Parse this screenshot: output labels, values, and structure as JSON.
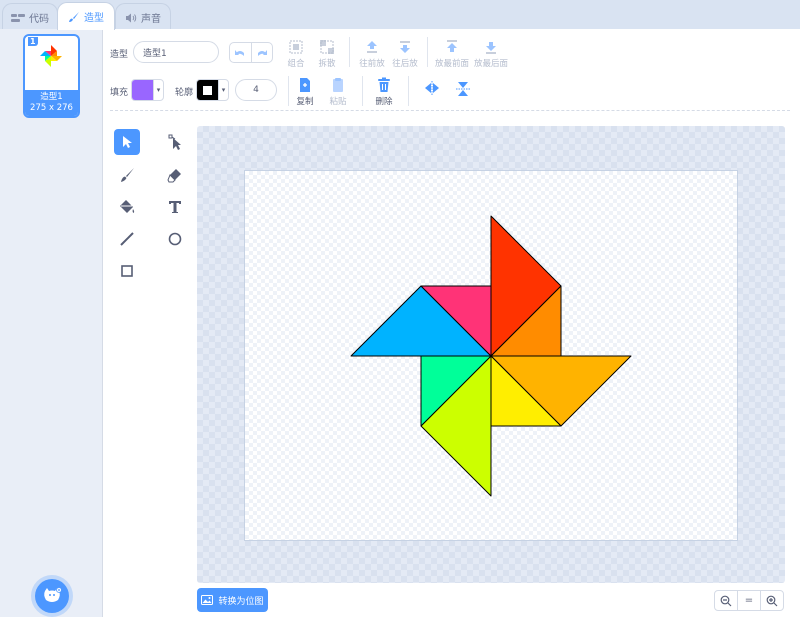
{
  "tabs": [
    {
      "label": "代码",
      "icon": "code-icon"
    },
    {
      "label": "造型",
      "icon": "brush-icon",
      "active": true
    },
    {
      "label": "声音",
      "icon": "speaker-icon"
    }
  ],
  "costume": {
    "number": "1",
    "name": "造型1",
    "size": "275 x 276"
  },
  "toolbar": {
    "costume_label": "造型",
    "costume_name": "造型1",
    "group": "组合",
    "ungroup": "拆散",
    "forward": "往前放",
    "backward": "往后放",
    "front": "放最前面",
    "back": "放最后面",
    "fill_label": "填充",
    "fill_color": "#9966ff",
    "outline_label": "轮廓",
    "outline_color": "#000000",
    "outline_width": "4",
    "copy": "复制",
    "paste": "粘贴",
    "delete": "删除"
  },
  "tools": [
    "select-tool",
    "reshape-tool",
    "brush-tool",
    "eraser-tool",
    "fill-tool",
    "text-tool",
    "line-tool",
    "circle-tool",
    "rectangle-tool"
  ],
  "bottom": {
    "convert_bitmap": "转换为位图",
    "zoom_reset": "="
  },
  "colors": {
    "accent": "#4c97ff"
  }
}
